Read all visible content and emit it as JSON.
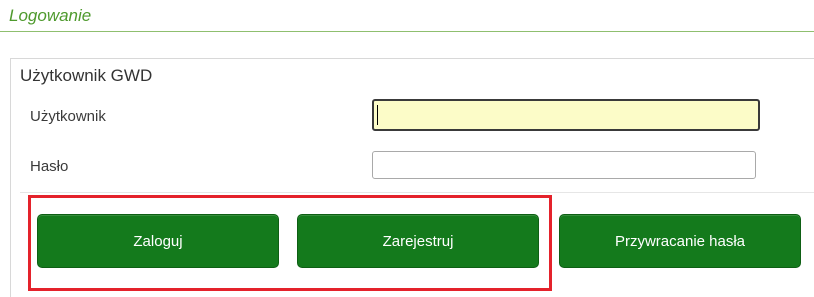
{
  "header": {
    "title": "Logowanie"
  },
  "panel": {
    "title": "Użytkownik GWD",
    "fields": {
      "username_label": "Użytkownik",
      "username_value": "",
      "password_label": "Hasło",
      "password_value": ""
    }
  },
  "buttons": {
    "login": "Zaloguj",
    "register": "Zarejestruj",
    "password_reset": "Przywracanie hasła"
  },
  "colors": {
    "header_text": "#4f9a2e",
    "button_bg": "#147a1c",
    "highlight_border": "#e4222b",
    "focused_input_bg": "#fcfcc8"
  }
}
